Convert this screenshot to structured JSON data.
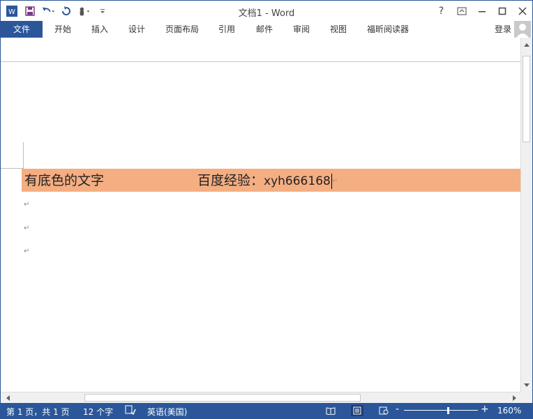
{
  "titlebar": {
    "title": "文档1 - Word",
    "icons": [
      "word-app-icon",
      "save-icon",
      "undo-icon",
      "redo-icon",
      "touch-mode-icon",
      "customize-qat-icon"
    ],
    "controls": {
      "help": "?",
      "ribbon_display": "ribbon-display-icon",
      "minimize": "minimize-icon",
      "maximize": "maximize-icon",
      "close": "close-icon"
    }
  },
  "ribbon": {
    "tabs": [
      "文件",
      "开始",
      "插入",
      "设计",
      "页面布局",
      "引用",
      "邮件",
      "审阅",
      "视图",
      "福昕阅读器"
    ],
    "login": "登录"
  },
  "document": {
    "line1_left": "有底色的文字",
    "line1_right_label": "百度经验：",
    "line1_right_code": "xyh666168",
    "paragraph_mark": "↵",
    "highlight_color": "#f4ae82"
  },
  "statusbar": {
    "page": "第 1 页，共 1 页",
    "words": "12 个字",
    "language": "英语(美国)",
    "zoom_minus": "-",
    "zoom_plus": "+",
    "zoom": "160%",
    "zoom_level_percent": 160
  },
  "colors": {
    "accent": "#2b579a"
  }
}
